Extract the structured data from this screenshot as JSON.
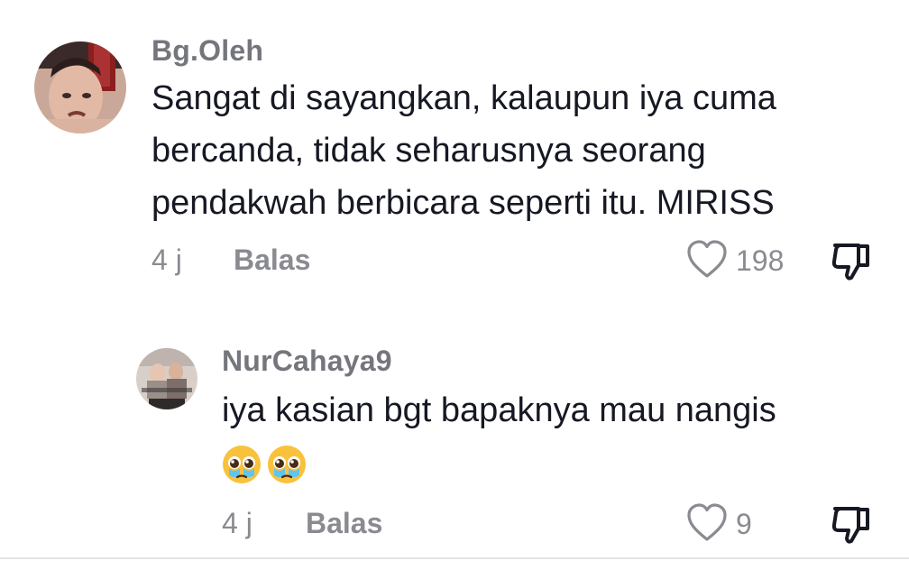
{
  "comments": [
    {
      "username": "Bg.Oleh",
      "text": "Sangat di sayangkan, kalaupun iya cuma bercanda, tidak seharusnya seorang pendakwah berbicara seperti itu. MIRISS",
      "time": "4 j",
      "reply_label": "Balas",
      "likes": "198",
      "avatar": "profile-photo"
    },
    {
      "username": "NurCahaya9",
      "text": "iya kasian bgt bapaknya mau nangis",
      "emojis": [
        "pleading-face-with-tears",
        "pleading-face-with-tears"
      ],
      "time": "4 j",
      "reply_label": "Balas",
      "likes": "9",
      "avatar": "profile-photo"
    }
  ],
  "icons": {
    "like": "heart-outline-icon",
    "dislike": "thumbs-down-icon"
  },
  "colors": {
    "primary_text": "#161823",
    "secondary_text": "#8a8b91",
    "username": "#75767d",
    "icon_stroke": "#8a8b91"
  }
}
